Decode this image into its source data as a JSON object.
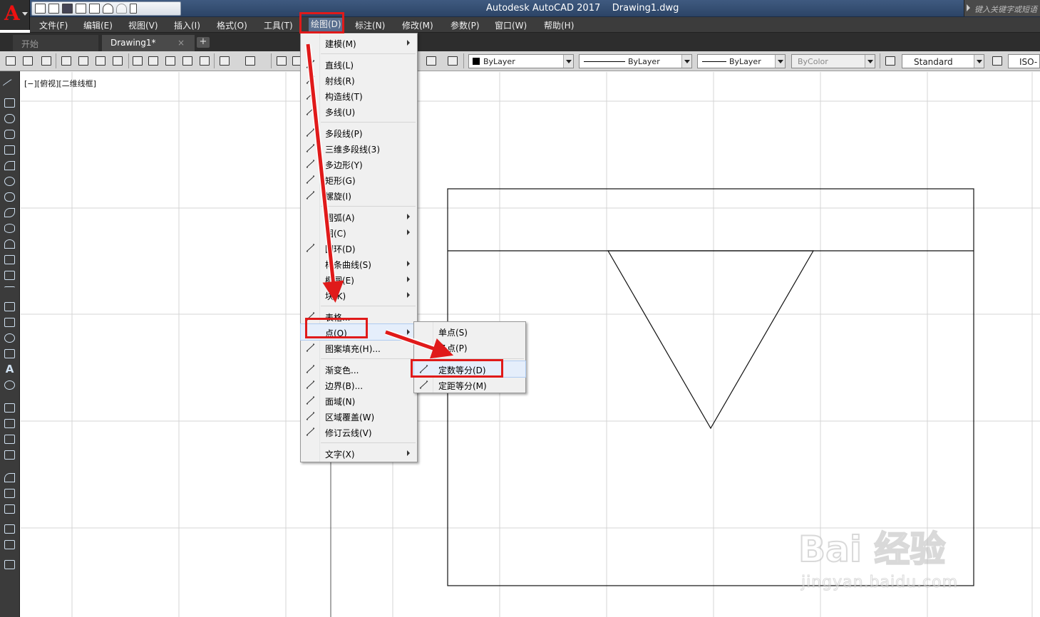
{
  "app": {
    "title": "Autodesk AutoCAD 2017    Drawing1.dwg",
    "logo_letter": "A",
    "search_placeholder": "键入关键字或短语"
  },
  "menubar": [
    "文件(F)",
    "编辑(E)",
    "视图(V)",
    "插入(I)",
    "格式(O)",
    "工具(T)",
    "绘图(D)",
    "标注(N)",
    "修改(M)",
    "参数(P)",
    "窗口(W)",
    "帮助(H)"
  ],
  "tabs": {
    "start": "开始",
    "drawing": "Drawing1*",
    "close_glyph": "×",
    "add_glyph": "+"
  },
  "toolbar": {
    "color": "ByLayer",
    "linetype": "ByLayer",
    "lineweight": "ByLayer",
    "plotstyle": "ByColor",
    "textstyle": "Standard",
    "dimstyle": "ISO-"
  },
  "viewport_label": "[−][俯视][二维线框]",
  "draw_menu": [
    {
      "label": "建模(M)",
      "icon": "",
      "submenu": true
    },
    {
      "sep": true
    },
    {
      "label": "直线(L)",
      "icon": "line-icon",
      "submenu": false
    },
    {
      "label": "射线(R)",
      "icon": "ray-icon",
      "submenu": false
    },
    {
      "label": "构造线(T)",
      "icon": "construction-line-icon",
      "submenu": false
    },
    {
      "label": "多线(U)",
      "icon": "multiline-icon",
      "submenu": false
    },
    {
      "sep": true
    },
    {
      "label": "多段线(P)",
      "icon": "polyline-icon",
      "submenu": false
    },
    {
      "label": "三维多段线(3)",
      "icon": "3d-polyline-icon",
      "submenu": false
    },
    {
      "label": "多边形(Y)",
      "icon": "polygon-icon",
      "submenu": false
    },
    {
      "label": "矩形(G)",
      "icon": "rectangle-icon",
      "submenu": false
    },
    {
      "label": "螺旋(I)",
      "icon": "helix-icon",
      "submenu": false
    },
    {
      "sep": true
    },
    {
      "label": "圆弧(A)",
      "icon": "",
      "submenu": true
    },
    {
      "label": "圆(C)",
      "icon": "",
      "submenu": true
    },
    {
      "label": "圆环(D)",
      "icon": "donut-icon",
      "submenu": false
    },
    {
      "label": "样条曲线(S)",
      "icon": "",
      "submenu": true
    },
    {
      "label": "椭圆(E)",
      "icon": "",
      "submenu": true
    },
    {
      "label": "块(K)",
      "icon": "",
      "submenu": true
    },
    {
      "sep": true
    },
    {
      "label": "表格...",
      "icon": "table-icon",
      "submenu": false
    },
    {
      "label": "点(O)",
      "icon": "",
      "submenu": true,
      "active": true
    },
    {
      "label": "图案填充(H)...",
      "icon": "hatch-icon",
      "submenu": false
    },
    {
      "sep": true
    },
    {
      "label": "渐变色...",
      "icon": "gradient-icon",
      "submenu": false
    },
    {
      "label": "边界(B)...",
      "icon": "boundary-icon",
      "submenu": false
    },
    {
      "label": "面域(N)",
      "icon": "region-icon",
      "submenu": false
    },
    {
      "label": "区域覆盖(W)",
      "icon": "wipeout-icon",
      "submenu": false
    },
    {
      "label": "修订云线(V)",
      "icon": "revcloud-icon",
      "submenu": false
    },
    {
      "sep": true
    },
    {
      "label": "文字(X)",
      "icon": "",
      "submenu": true
    }
  ],
  "point_submenu": [
    {
      "label": "单点(S)",
      "icon": ""
    },
    {
      "label": "多点(P)",
      "icon": ""
    },
    {
      "label": "定数等分(D)",
      "icon": "divide-icon",
      "active": true
    },
    {
      "label": "定距等分(M)",
      "icon": "measure-icon"
    }
  ],
  "watermark": {
    "brand": "Bai 经验",
    "url": "jingyan.baidu.com"
  },
  "colors": {
    "highlight": "#e01a1a",
    "title_bar": "#2f4a70",
    "menubar": "#3c3c3c"
  }
}
